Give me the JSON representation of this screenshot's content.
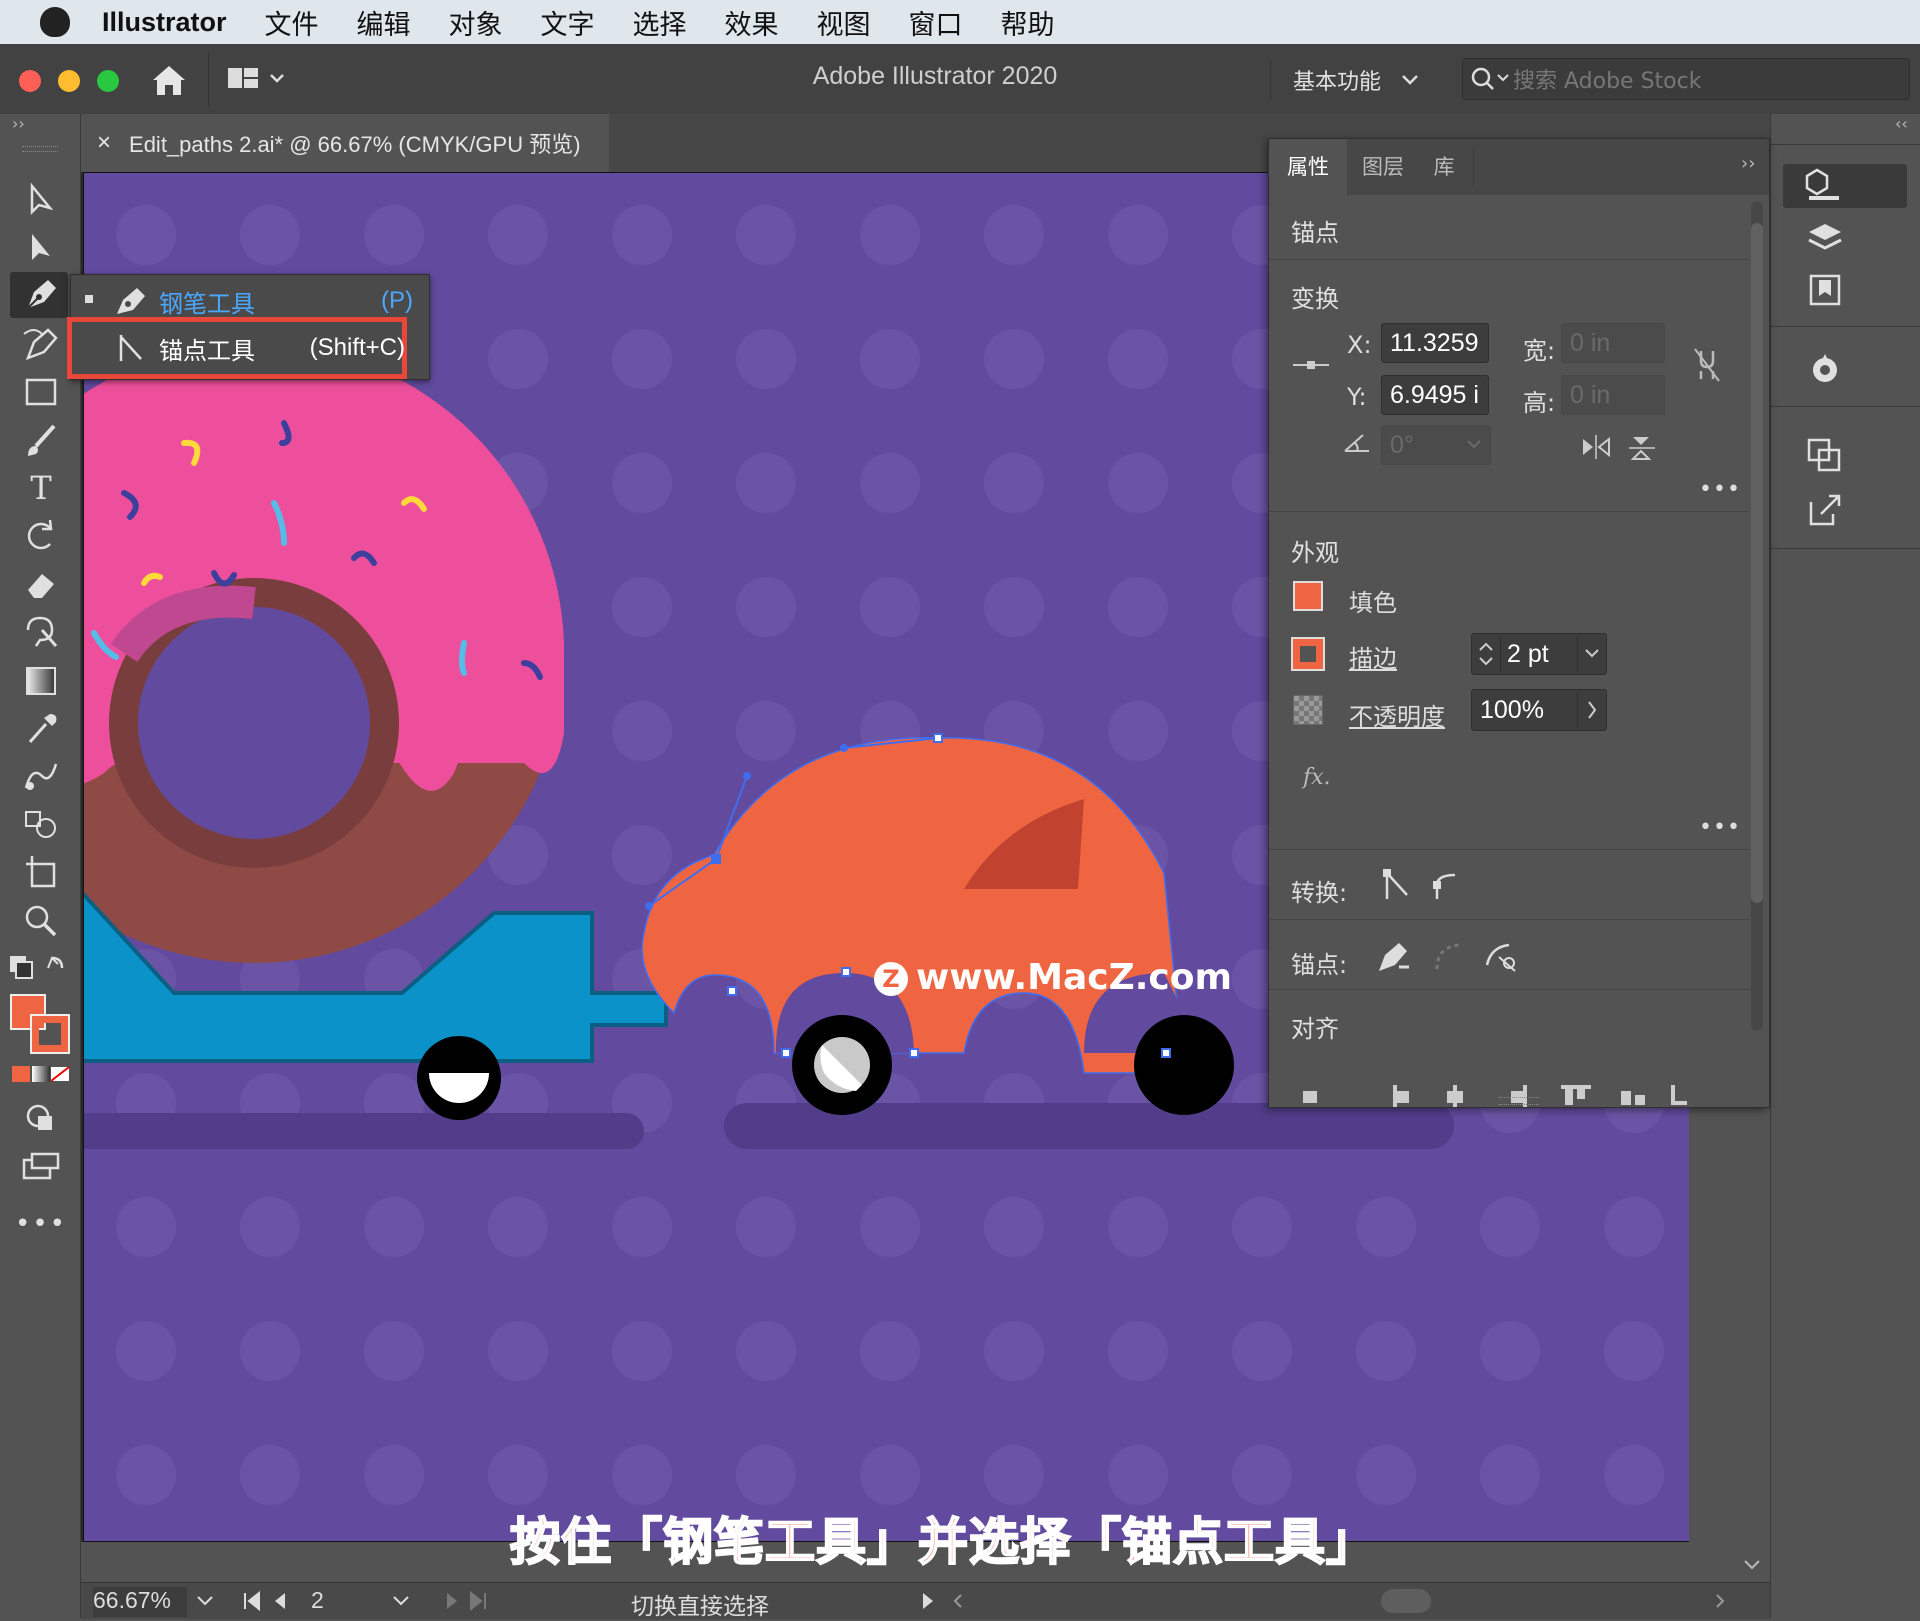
{
  "menubar": {
    "app_name": "Illustrator",
    "items": [
      "文件",
      "编辑",
      "对象",
      "文字",
      "选择",
      "效果",
      "视图",
      "窗口",
      "帮助"
    ]
  },
  "titlebar": {
    "title": "Adobe Illustrator 2020",
    "workspace": "基本功能",
    "stock_placeholder": "搜索 Adobe Stock"
  },
  "document_tab": {
    "close": "×",
    "title": "Edit_paths 2.ai* @ 66.67% (CMYK/GPU 预览)"
  },
  "flyout": {
    "pen": {
      "label": "钢笔工具",
      "shortcut": "(P)"
    },
    "anchor": {
      "label": "锚点工具",
      "shortcut": "(Shift+C)"
    }
  },
  "panel": {
    "tabs": [
      "属性",
      "图层",
      "库"
    ],
    "selection_type": "锚点",
    "transform": {
      "title": "变换",
      "x_label": "X:",
      "x_value": "11.3259",
      "y_label": "Y:",
      "y_value": "6.9495 i",
      "w_label": "宽:",
      "w_value": "0 in",
      "h_label": "高:",
      "h_value": "0 in",
      "angle_value": "0°"
    },
    "appearance": {
      "title": "外观",
      "fill_label": "填色",
      "stroke_label": "描边",
      "stroke_value": "2 pt",
      "opacity_label": "不透明度",
      "opacity_value": "100%",
      "fx_label": "fx."
    },
    "convert_label": "转换:",
    "anchor_label": "锚点:",
    "align_title": "对齐"
  },
  "canvas": {
    "watermark": "www.MacZ.com",
    "subtitle": "按住「钢笔工具」并选择「锚点工具」"
  },
  "statusbar": {
    "zoom": "66.67%",
    "artboard": "2",
    "status": "切换直接选择"
  },
  "colors": {
    "artboard": "#624a9e",
    "car": "#f06541",
    "donut_icing": "#ee4f9c",
    "donut_dough": "#8f4a45",
    "trailer": "#0b93c9",
    "highlight": "#e8473a",
    "anchor_blue": "#3f6df0"
  }
}
